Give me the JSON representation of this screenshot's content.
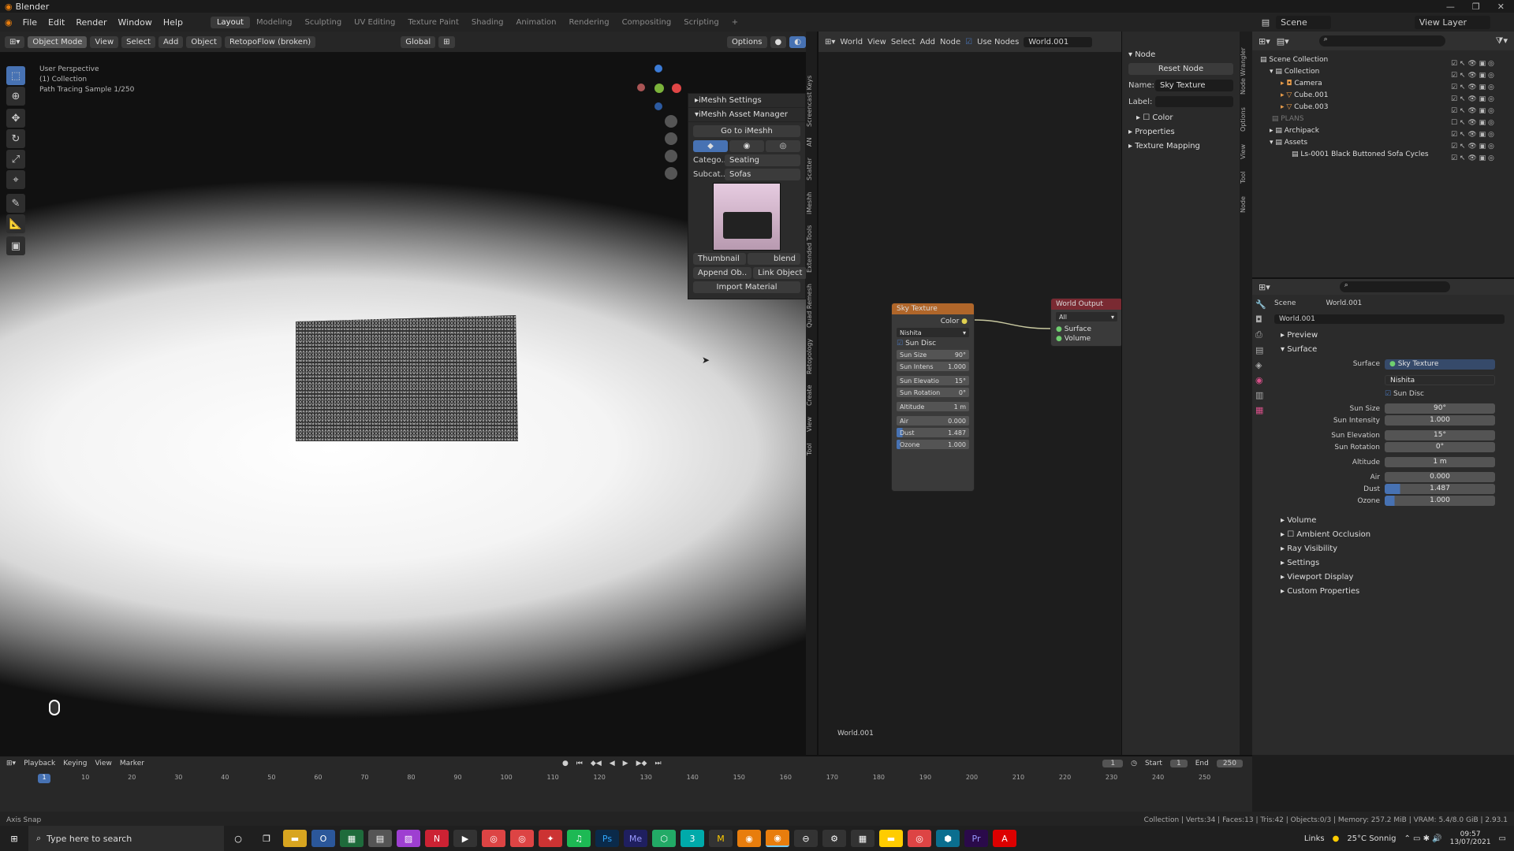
{
  "window": {
    "title": "Blender"
  },
  "menu": {
    "items": [
      "File",
      "Edit",
      "Render",
      "Window",
      "Help"
    ],
    "workspaces": [
      "Layout",
      "Modeling",
      "Sculpting",
      "UV Editing",
      "Texture Paint",
      "Shading",
      "Animation",
      "Rendering",
      "Compositing",
      "Scripting"
    ],
    "active_workspace": "Layout",
    "scene": "Scene",
    "view_layer": "View Layer"
  },
  "viewport": {
    "mode": "Object Mode",
    "menu": [
      "View",
      "Select",
      "Add",
      "Object"
    ],
    "retopo": "RetopoFlow (broken)",
    "orientation": "Global",
    "options": "Options",
    "overlay_lines": [
      "User Perspective",
      "(1) Collection",
      "Path Tracing Sample 1/250"
    ]
  },
  "imeshh": {
    "settings": "iMeshh Settings",
    "manager": "iMeshh Asset Manager",
    "goto": "Go to iMeshh",
    "category_label": "Catego...",
    "category": "Seating",
    "subcat_label": "Subcat...",
    "subcat": "Sofas",
    "thumbnail": "Thumbnail",
    "blend": "blend",
    "append": "Append Ob..",
    "link": "Link Object",
    "import": "Import Material"
  },
  "side_tabs": [
    "Tool",
    "View",
    "Create",
    "Retopology",
    "Quad Remesh",
    "Extended Tools",
    "iMeshh",
    "Scatter",
    "AN",
    "Screencast Keys"
  ],
  "node_editor": {
    "world_menu": "World",
    "menu": [
      "View",
      "Select",
      "Add",
      "Node"
    ],
    "use_nodes": "Use Nodes",
    "world_name": "World.001",
    "footer": "World.001"
  },
  "sky_node": {
    "title": "Sky Texture",
    "output": "Color",
    "type": "Nishita",
    "sun_disc": "Sun Disc",
    "fields": [
      {
        "label": "Sun Size",
        "value": "90°"
      },
      {
        "label": "Sun Intens",
        "value": "1.000"
      },
      {
        "label": "Sun Elevatio",
        "value": "15°"
      },
      {
        "label": "Sun Rotation",
        "value": "0°"
      },
      {
        "label": "Altitude",
        "value": "1 m"
      },
      {
        "label": "Air",
        "value": "0.000"
      },
      {
        "label": "Dust",
        "value": "1.487"
      },
      {
        "label": "Ozone",
        "value": "1.000"
      }
    ]
  },
  "world_output": {
    "title": "World Output",
    "target": "All",
    "sockets": [
      "Surface",
      "Volume"
    ]
  },
  "node_panel": {
    "header": "Node",
    "reset": "Reset Node",
    "name_label": "Name:",
    "name": "Sky Texture",
    "label_label": "Label:",
    "color": "Color",
    "properties": "Properties",
    "mapping": "Texture Mapping"
  },
  "node_tabs": [
    "Node",
    "Tool",
    "View",
    "Options",
    "Node Wrangler"
  ],
  "outliner": {
    "items": [
      {
        "name": "Scene Collection",
        "indent": 0
      },
      {
        "name": "Collection",
        "indent": 1
      },
      {
        "name": "Camera",
        "indent": 2
      },
      {
        "name": "Cube.001",
        "indent": 2
      },
      {
        "name": "Cube.003",
        "indent": 2
      },
      {
        "name": "PLANS",
        "indent": 1
      },
      {
        "name": "Archipack",
        "indent": 1
      },
      {
        "name": "Assets",
        "indent": 1
      },
      {
        "name": "Ls-0001 Black Buttoned Sofa Cycles",
        "indent": 2
      }
    ]
  },
  "properties": {
    "scene": "Scene",
    "world": "World.001",
    "world_field": "World.001",
    "preview": "Preview",
    "surface_section": "Surface",
    "surface_label": "Surface",
    "surface_value": "Sky Texture",
    "type": "Nishita",
    "sun_disc": "Sun Disc",
    "rows": [
      {
        "label": "Sun Size",
        "value": "90°"
      },
      {
        "label": "Sun Intensity",
        "value": "1.000"
      },
      {
        "label": "Sun Elevation",
        "value": "15°"
      },
      {
        "label": "Sun Rotation",
        "value": "0°"
      },
      {
        "label": "Altitude",
        "value": "1 m"
      },
      {
        "label": "Air",
        "value": "0.000"
      },
      {
        "label": "Dust",
        "value": "1.487"
      },
      {
        "label": "Ozone",
        "value": "1.000"
      }
    ],
    "sections": [
      "Volume",
      "Ambient Occlusion",
      "Ray Visibility",
      "Settings",
      "Viewport Display",
      "Custom Properties"
    ]
  },
  "timeline": {
    "menu": [
      "Playback",
      "Keying",
      "View",
      "Marker"
    ],
    "current": "1",
    "start_label": "Start",
    "start": "1",
    "end_label": "End",
    "end": "250",
    "ticks": [
      "1",
      "10",
      "20",
      "30",
      "40",
      "50",
      "60",
      "70",
      "80",
      "90",
      "100",
      "110",
      "120",
      "130",
      "140",
      "150",
      "160",
      "170",
      "180",
      "190",
      "200",
      "210",
      "220",
      "230",
      "240",
      "250"
    ]
  },
  "status": {
    "left": "Axis Snap",
    "right": "Collection | Verts:34 | Faces:13 | Tris:42 | Objects:0/3 | Memory: 257.2 MiB | VRAM: 5.4/8.0 GiB | 2.93.1"
  },
  "taskbar": {
    "search": "Type here to search",
    "links": "Links",
    "weather": "25°C Sonnig",
    "time": "09:57",
    "date": "13/07/2021"
  }
}
